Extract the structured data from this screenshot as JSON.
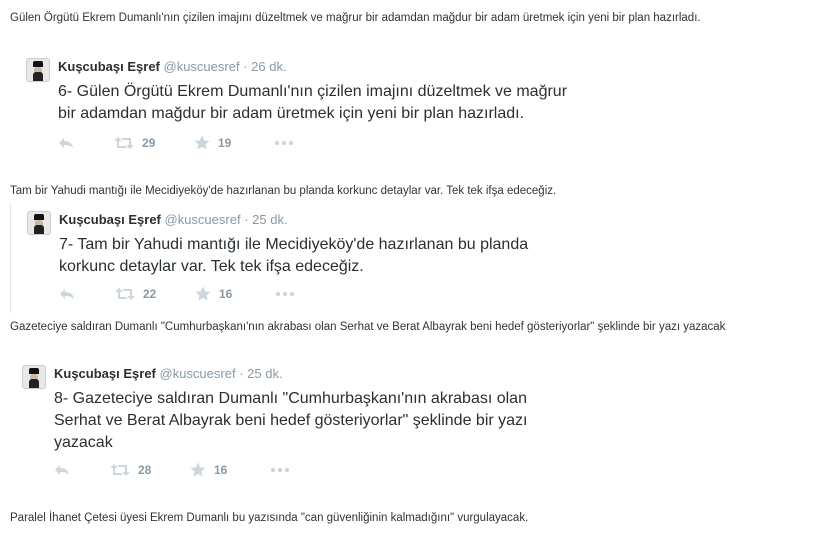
{
  "captions": [
    "Gülen Örgütü Ekrem Dumanlı'nın çizilen imajını düzeltmek ve mağrur bir adamdan mağdur bir adam üretmek için yeni bir plan hazırladı.",
    "Tam bir Yahudi mantığı ile Mecidiyeköy'de hazırlanan bu planda korkunc detaylar var. Tek tek ifşa edeceğiz.",
    "Gazeteciye saldıran Dumanlı \"Cumhurbaşkanı'nın akrabası olan Serhat ve Berat Albayrak beni hedef gösteriyorlar\" şeklinde bir yazı yazacak",
    "Paralel İhanet Çetesi üyesi Ekrem Dumanlı bu yazısında \"can güvenliğinin kalmadığını\" vurgulayacak."
  ],
  "tweets": [
    {
      "name": "Kuşcubaşı Eşref",
      "handle": "@kuscuesref",
      "dot": "·",
      "time": "26 dk.",
      "lines": [
        "6- Gülen Örgütü Ekrem Dumanlı'nın çizilen imajını düzeltmek ve mağrur",
        "bir adamdan mağdur bir adam üretmek için yeni bir plan hazırladı."
      ],
      "retweets": "29",
      "favorites": "19"
    },
    {
      "name": "Kuşcubaşı Eşref",
      "handle": "@kuscuesref",
      "dot": "·",
      "time": "25 dk.",
      "lines": [
        "7- Tam bir Yahudi mantığı ile Mecidiyeköy'de hazırlanan bu planda",
        "korkunc detaylar var. Tek tek ifşa edeceğiz."
      ],
      "retweets": "22",
      "favorites": "16"
    },
    {
      "name": "Kuşcubaşı Eşref",
      "handle": "@kuscuesref",
      "dot": "·",
      "time": "25 dk.",
      "lines": [
        "8- Gazeteciye saldıran Dumanlı \"Cumhurbaşkanı'nın akrabası olan",
        "Serhat ve Berat Albayrak beni hedef gösteriyorlar\" şeklinde bir yazı",
        "yazacak"
      ],
      "retweets": "28",
      "favorites": "16"
    }
  ],
  "icons": {
    "reply": "reply-icon",
    "retweet": "retweet-icon",
    "favorite": "star-icon",
    "more": "more-icon"
  }
}
